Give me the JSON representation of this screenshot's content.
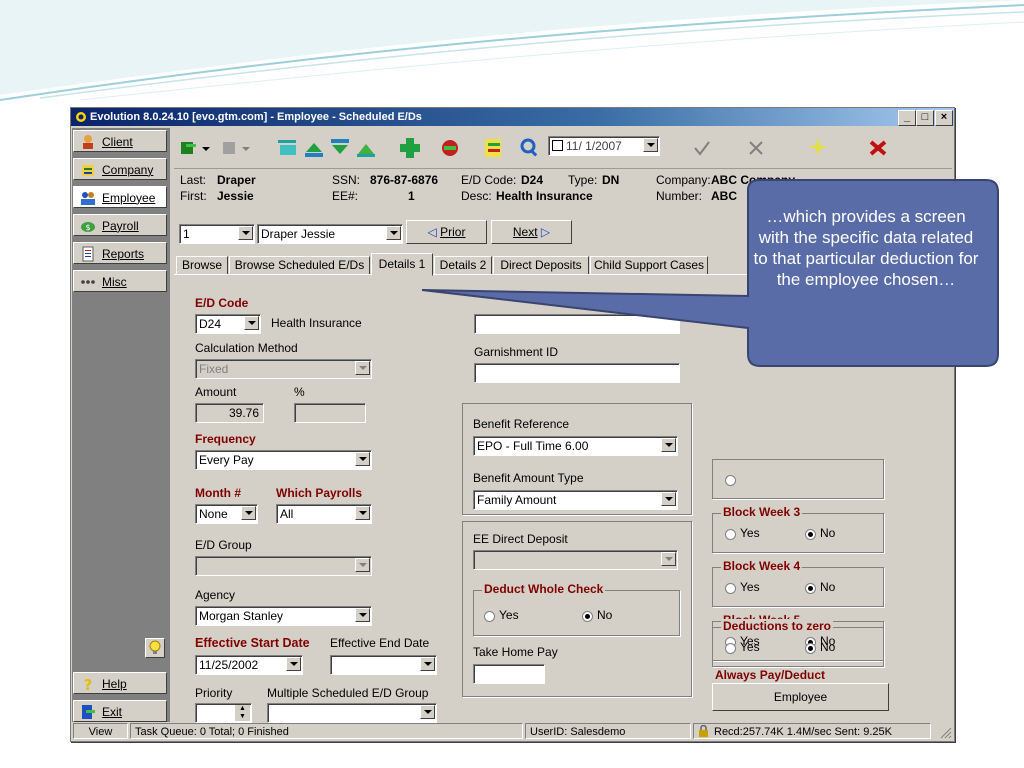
{
  "window": {
    "title": "Evolution 8.0.24.10 [evo.gtm.com] - Employee - Scheduled E/Ds",
    "min_label": "_",
    "max_label": "□",
    "close_label": "×"
  },
  "nav": {
    "items": [
      {
        "label": "Client"
      },
      {
        "label": "Company"
      },
      {
        "label": "Employee"
      },
      {
        "label": "Payroll"
      },
      {
        "label": "Reports"
      },
      {
        "label": "Misc"
      }
    ],
    "help_label": "Help",
    "exit_label": "Exit"
  },
  "toolbar": {
    "date": "11/ 1/2007"
  },
  "info": {
    "last_label": "Last:",
    "last_value": "Draper",
    "first_label": "First:",
    "first_value": "Jessie",
    "ssn_label": "SSN:",
    "ssn_value": "876-87-6876",
    "ee_label": "EE#:",
    "ee_value": "1",
    "ed_code_label": "E/D Code:",
    "ed_code_value": "D24",
    "type_label": "Type:",
    "type_value": "DN",
    "desc_label": "Desc:",
    "desc_value": "Health Insurance",
    "company_label": "Company:",
    "company_value": "ABC Company",
    "number_label": "Number:",
    "number_value": "ABC"
  },
  "selector": {
    "number": "1",
    "name": "Draper Jessie",
    "prior_label": "Prior",
    "next_label": "Next"
  },
  "tabs": [
    {
      "label": "Browse"
    },
    {
      "label": "Browse Scheduled E/Ds"
    },
    {
      "label": "Details 1"
    },
    {
      "label": "Details 2"
    },
    {
      "label": "Direct Deposits"
    },
    {
      "label": "Child Support Cases"
    }
  ],
  "form": {
    "ed_code_label": "E/D Code",
    "ed_code_value": "D24",
    "ed_code_desc": "Health Insurance",
    "calc_method_label": "Calculation Method",
    "calc_method_value": "Fixed",
    "amount_label": "Amount",
    "amount_value": "39.76",
    "percent_label": "%",
    "frequency_label": "Frequency",
    "frequency_value": "Every Pay",
    "month_label": "Month #",
    "month_value": "None",
    "which_payrolls_label": "Which Payrolls",
    "which_payrolls_value": "All",
    "ed_group_label": "E/D Group",
    "agency_label": "Agency",
    "agency_value": "Morgan Stanley",
    "eff_start_label": "Effective Start Date",
    "eff_start_value": "11/25/2002",
    "eff_end_label": "Effective End Date",
    "priority_label": "Priority",
    "multiple_group_label": "Multiple Scheduled E/D Group",
    "garnishment_label": "Garnishment ID",
    "benefit_ref_label": "Benefit Reference",
    "benefit_ref_value": "EPO - Full Time 6.00",
    "benefit_amount_type_label": "Benefit Amount Type",
    "benefit_amount_type_value": "Family Amount",
    "ee_direct_deposit_label": "EE Direct Deposit",
    "deduct_whole_check_label": "Deduct Whole Check",
    "take_home_label": "Take Home Pay",
    "block_week3_label": "Block Week 3",
    "block_week4_label": "Block Week 4",
    "block_week5_label": "Block Week 5",
    "yes_label": "Yes",
    "no_label": "No",
    "always_pay_label": "Always Pay/Deduct",
    "always_pay_value": "No",
    "deductions_zero_label": "Deductions to zero",
    "employee_button": "Employee"
  },
  "status": {
    "view": "View",
    "task_queue": "Task Queue: 0 Total; 0 Finished",
    "user": "UserID: Salesdemo",
    "transfer": "Recd:257.74K  1.4M/sec  Sent: 9.25K"
  },
  "callout": {
    "text": "…which provides a screen with the specific data related to that particular deduction for the employee chosen…"
  },
  "colors": {
    "title_bar": "#0a246a",
    "label_red": "#800000",
    "callout_fill": "#5a6ca8",
    "callout_border": "#3a4470"
  }
}
